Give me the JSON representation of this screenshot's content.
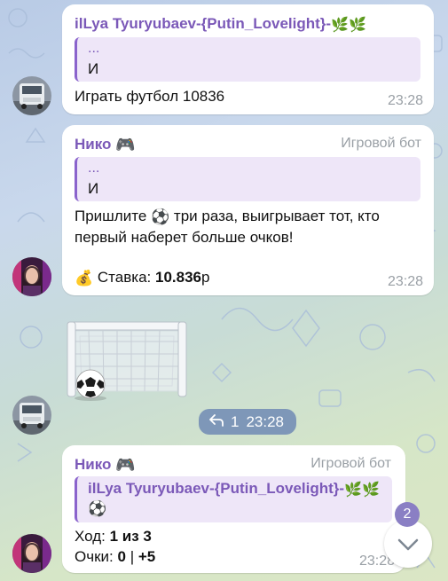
{
  "messages": [
    {
      "sender": "ilLya Tyuryubaev-{Putin_Lovelight}-",
      "sender_emoji": "🌿🌿",
      "quote_line1": "...",
      "quote_line2": "И",
      "text": "Играть футбол 10836",
      "time": "23:28",
      "avatar": "truck-avatar"
    },
    {
      "sender": "Нико",
      "sender_emoji": "🎮",
      "role": "Игровой бот",
      "quote_line1": "...",
      "quote_line2": "И",
      "text_line1": "Пришлите",
      "text_emoji": "⚽",
      "text_line1b": "три раза, выигрывает тот, кто",
      "text_line2": "первый наберет больше очков!",
      "stake_emoji": "💰",
      "stake_label": "Ставка:",
      "stake_value": "10.836",
      "stake_currency": "р",
      "time": "23:28",
      "avatar": "girl-avatar"
    },
    {
      "type": "football-goal-sticker",
      "reply_count": "1",
      "time": "23:28"
    },
    {
      "sender": "Нико",
      "sender_emoji": "🎮",
      "role": "Игровой бот",
      "quote_sender": "ilLya Tyuryubaev-{Putin_Lovelight}-",
      "quote_sender_emoji": "🌿🌿",
      "quote_body_emoji": "⚽",
      "turn_label": "Ход:",
      "turn_value": "1 из 3",
      "score_label": "Очки:",
      "score_value": "0",
      "score_sep": "|",
      "score_bonus": "+5",
      "time": "23:28"
    }
  ],
  "scroll": {
    "unread_count": "2"
  },
  "colors": {
    "accent": "#7b59b8",
    "quote_bg": "#eee6f8",
    "pill": "#7e97b8",
    "badge": "#8a7fc4"
  }
}
